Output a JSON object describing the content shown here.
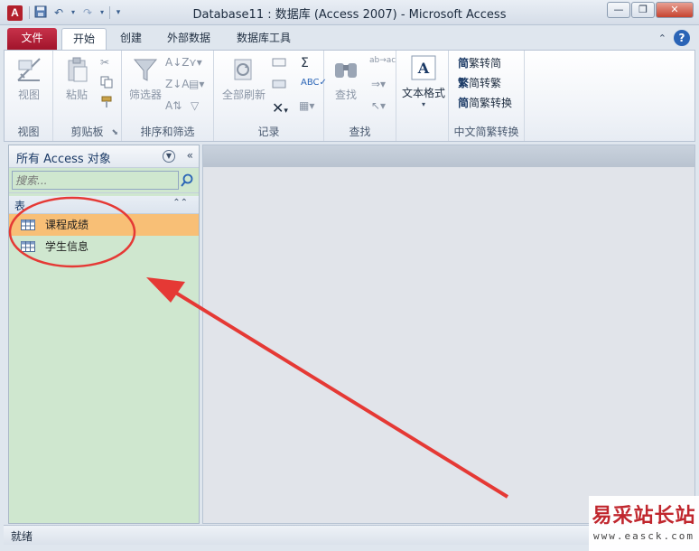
{
  "window": {
    "title": "Database11 : 数据库 (Access 2007) - Microsoft Access",
    "app_icon_letter": "A"
  },
  "tabs": [
    {
      "label": "文件"
    },
    {
      "label": "开始"
    },
    {
      "label": "创建"
    },
    {
      "label": "外部数据"
    },
    {
      "label": "数据库工具"
    }
  ],
  "ribbon": {
    "groups": {
      "view": {
        "label": "视图",
        "button": "视图"
      },
      "clipboard": {
        "label": "剪贴板",
        "paste": "粘贴"
      },
      "sort_filter": {
        "label": "排序和筛选",
        "filter": "筛选器"
      },
      "records": {
        "label": "记录",
        "refresh_all": "全部刷新"
      },
      "find": {
        "label": "查找",
        "find": "查找"
      },
      "text_format": {
        "label": "文本格式"
      },
      "convert": {
        "label": "中文简繁转换",
        "to_simplified": "繁转简",
        "to_traditional": "简转繁",
        "convert": "简繁转换"
      }
    }
  },
  "nav": {
    "title": "所有 Access 对象",
    "search_placeholder": "搜索...",
    "category": "表",
    "items": [
      {
        "label": "课程成绩"
      },
      {
        "label": "学生信息"
      }
    ]
  },
  "status": {
    "text": "就绪"
  },
  "watermark": {
    "text": "易采站长站",
    "url": "www.easck.com"
  },
  "colors": {
    "file_tab": "#b01e35",
    "nav_bg": "#cfe7cf",
    "selected": "#f8bf76",
    "annotation": "#e53935"
  }
}
